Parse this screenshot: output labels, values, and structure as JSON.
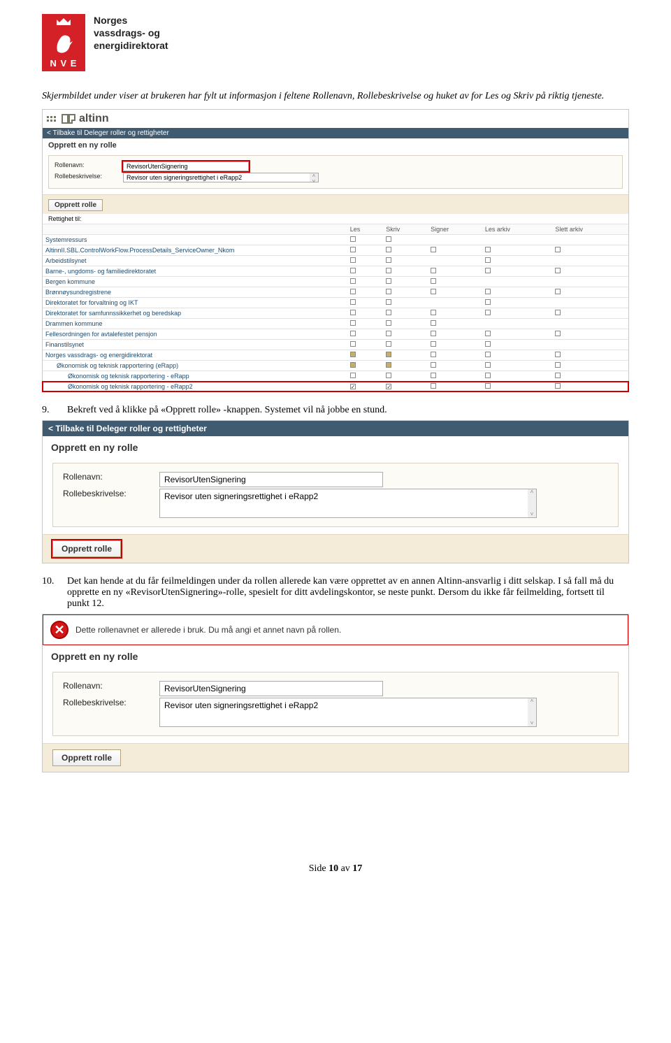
{
  "header_org": {
    "line1": "Norges",
    "line2": "vassdrags- og",
    "line3": "energidirektorat",
    "acro": "N V E"
  },
  "intro": "Skjermbildet under viser at brukeren har fylt ut informasjon i feltene Rollenavn, Rollebeskrivelse og huket av for Les og Skriv på riktig tjeneste.",
  "fig1": {
    "altinn": "altinn",
    "back": "<  Tilbake til Deleger roller og rettigheter",
    "section": "Opprett en ny rolle",
    "rollenavn_lbl": "Rollenavn:",
    "rollenavn_val": "RevisorUtenSignering",
    "rollebesk_lbl": "Rollebeskrivelse:",
    "rollebesk_val": "Revisor uten signeringsrettighet i eRapp2",
    "btn": "Opprett rolle",
    "rights_lbl": "Rettighet til:",
    "cols": {
      "les": "Les",
      "skriv": "Skriv",
      "signer": "Signer",
      "lesarkiv": "Les arkiv",
      "slettarkiv": "Slett arkiv"
    },
    "rows": [
      {
        "name": "Systemressurs",
        "c": [
          0,
          0,
          null,
          null,
          null
        ]
      },
      {
        "name": "AltinnII.SBL.ControlWorkFlow.ProcessDetails_ServiceOwner_Nkom",
        "c": [
          0,
          0,
          0,
          0,
          0
        ]
      },
      {
        "name": "Arbeidstilsynet",
        "c": [
          0,
          0,
          null,
          0,
          null
        ]
      },
      {
        "name": "Barne-, ungdoms- og familiedirektoratet",
        "c": [
          0,
          0,
          0,
          0,
          0
        ]
      },
      {
        "name": "Bergen kommune",
        "c": [
          0,
          0,
          0,
          null,
          null
        ]
      },
      {
        "name": "Brønnøysundregistrene",
        "c": [
          0,
          0,
          0,
          0,
          0
        ]
      },
      {
        "name": "Direktoratet for forvaltning og IKT",
        "c": [
          0,
          0,
          null,
          0,
          null
        ]
      },
      {
        "name": "Direktoratet for samfunnssikkerhet og beredskap",
        "c": [
          0,
          0,
          0,
          0,
          0
        ]
      },
      {
        "name": "Drammen kommune",
        "c": [
          0,
          0,
          0,
          null,
          null
        ]
      },
      {
        "name": "Fellesordningen for avtalefestet pensjon",
        "c": [
          0,
          0,
          0,
          0,
          0
        ]
      },
      {
        "name": "Finanstilsynet",
        "c": [
          0,
          0,
          0,
          0,
          null
        ]
      },
      {
        "name": "Norges vassdrags- og energidirektorat",
        "c": [
          2,
          2,
          0,
          0,
          0
        ]
      },
      {
        "name": "Økonomisk og teknisk rapportering (eRapp)",
        "c": [
          2,
          2,
          0,
          0,
          0
        ],
        "indent": 1
      },
      {
        "name": "Økonomisk og teknisk rapportering - eRapp",
        "c": [
          0,
          0,
          0,
          0,
          0
        ],
        "indent": 2
      },
      {
        "name": "Økonomisk og teknisk rapportering - eRapp2",
        "c": [
          3,
          3,
          0,
          0,
          0
        ],
        "indent": 2,
        "hl": true
      }
    ]
  },
  "step9": {
    "num": "9.",
    "text": "Bekreft ved å klikke på «Opprett rolle» -knappen. Systemet vil nå jobbe en stund."
  },
  "fig2": {
    "back": "<  Tilbake til Deleger roller og rettigheter",
    "section": "Opprett en ny rolle",
    "rollenavn_lbl": "Rollenavn:",
    "rollenavn_val": "RevisorUtenSignering",
    "rollebesk_lbl": "Rollebeskrivelse:",
    "rollebesk_val": "Revisor uten signeringsrettighet i eRapp2",
    "btn": "Opprett rolle"
  },
  "step10": {
    "num": "10.",
    "text": "Det kan hende at du får feilmeldingen under da rollen allerede kan være opprettet av en annen Altinn-ansvarlig i ditt selskap. I så fall må du opprette en ny «RevisorUtenSignering»-rolle, spesielt for ditt avdelingskontor, se neste punkt. Dersom du ikke får feilmelding, fortsett til punkt 12."
  },
  "fig3": {
    "error": "Dette rollenavnet er allerede i bruk. Du må angi et annet navn på rollen.",
    "section": "Opprett en ny rolle",
    "rollenavn_lbl": "Rollenavn:",
    "rollenavn_val": "RevisorUtenSignering",
    "rollebesk_lbl": "Rollebeskrivelse:",
    "rollebesk_val": "Revisor uten signeringsrettighet i eRapp2",
    "btn": "Opprett rolle"
  },
  "footer": {
    "pre": "Side ",
    "num": "10",
    "mid": " av ",
    "tot": "17"
  }
}
